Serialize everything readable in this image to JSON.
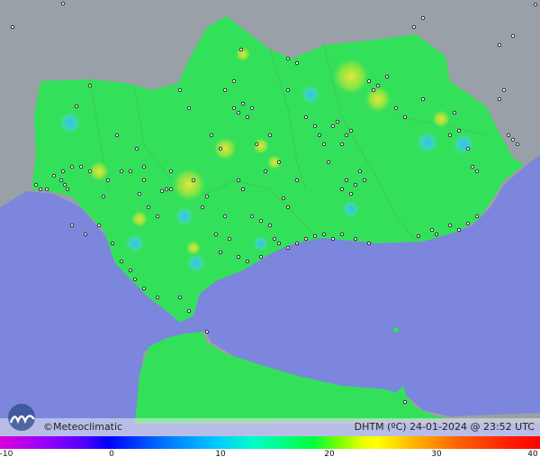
{
  "map": {
    "title_variable": "DHTM (ºC)",
    "timestamp": "24-01-2024 @ 23:52 UTC",
    "colors": {
      "sea": "#7b86dc",
      "land_outside": "#9aa0a8",
      "region_land": "#33e05a",
      "warm_spot": "#d6e23a",
      "cool_spot": "#46d6d0"
    }
  },
  "brand": {
    "copyright": "©",
    "name": "Meteoclimatic",
    "logo_icon": "meteoclimatic-logo-icon"
  },
  "scale": {
    "unit": "ºC",
    "min": -10,
    "max": 40,
    "ticks": [
      "-10",
      "0",
      "10",
      "20",
      "30",
      "40"
    ]
  }
}
